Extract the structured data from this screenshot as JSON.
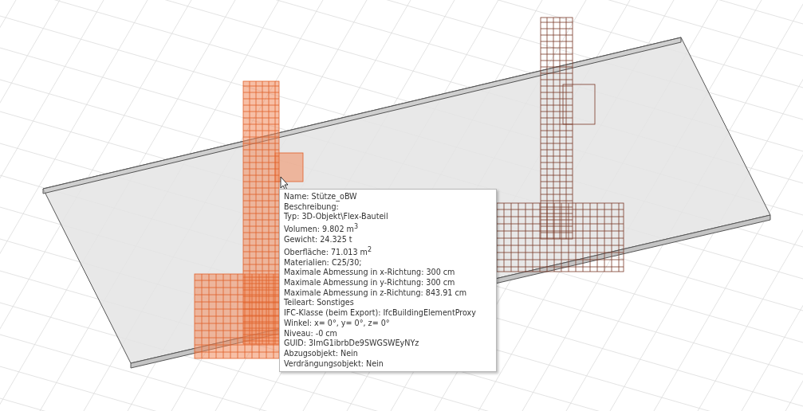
{
  "viewport": {
    "objects": [
      {
        "kind": "column",
        "selected": true
      },
      {
        "kind": "column",
        "selected": false
      }
    ]
  },
  "tooltip": {
    "lines": [
      "Name: Stütze_oBW",
      "Beschreibung:",
      "Typ: 3D-Objekt\\Flex-Bauteil",
      "Volumen: 9.802 m$^{3}$",
      "Gewicht: 24.325 t",
      "Oberfläche: 71.013 m$^{2}$",
      "Materialien: C25/30;",
      "Maximale Abmessung in x-Richtung: 300 cm",
      "Maximale Abmessung in y-Richtung: 300 cm",
      "Maximale Abmessung in z-Richtung: 843.91 cm",
      "Teileart: Sonstiges",
      "IFC-Klasse (beim Export): IfcBuildingElementProxy",
      "Winkel: x= 0°, y= 0°, z= 0°",
      "Niveau: -0 cm",
      "GUID: 3ImG1ibrbDe9SWGSWEyNYz",
      "Abzugsobjekt: Nein",
      "Verdrängungsobjekt: Nein"
    ]
  }
}
